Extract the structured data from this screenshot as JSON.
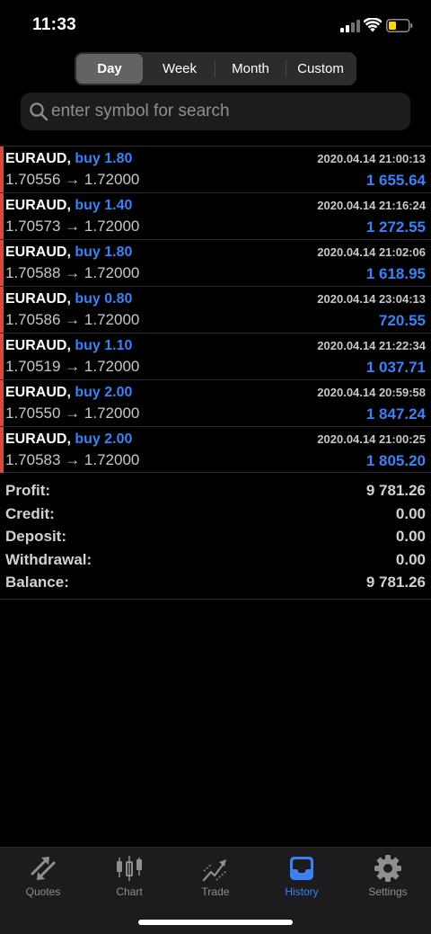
{
  "status_bar": {
    "time": "11:33"
  },
  "segments": [
    {
      "label": "Day",
      "active": true
    },
    {
      "label": "Week",
      "active": false
    },
    {
      "label": "Month",
      "active": false
    },
    {
      "label": "Custom",
      "active": false
    }
  ],
  "search": {
    "placeholder": "enter symbol for search",
    "value": ""
  },
  "deals": [
    {
      "symbol": "EURAUD,",
      "type": "buy 1.80",
      "prices": "1.70556 → 1.72000",
      "time": "2020.04.14 21:00:13",
      "profit": "1 655.64"
    },
    {
      "symbol": "EURAUD,",
      "type": "buy 1.40",
      "prices": "1.70573 → 1.72000",
      "time": "2020.04.14 21:16:24",
      "profit": "1 272.55"
    },
    {
      "symbol": "EURAUD,",
      "type": "buy 1.80",
      "prices": "1.70588 → 1.72000",
      "time": "2020.04.14 21:02:06",
      "profit": "1 618.95"
    },
    {
      "symbol": "EURAUD,",
      "type": "buy 0.80",
      "prices": "1.70586 → 1.72000",
      "time": "2020.04.14 23:04:13",
      "profit": "720.55"
    },
    {
      "symbol": "EURAUD,",
      "type": "buy 1.10",
      "prices": "1.70519 → 1.72000",
      "time": "2020.04.14 21:22:34",
      "profit": "1 037.71"
    },
    {
      "symbol": "EURAUD,",
      "type": "buy 2.00",
      "prices": "1.70550 → 1.72000",
      "time": "2020.04.14 20:59:58",
      "profit": "1 847.24"
    },
    {
      "symbol": "EURAUD,",
      "type": "buy 2.00",
      "prices": "1.70583 → 1.72000",
      "time": "2020.04.14 21:00:25",
      "profit": "1 805.20"
    }
  ],
  "summary": {
    "profit": {
      "label": "Profit:",
      "value": "9 781.26"
    },
    "credit": {
      "label": "Credit:",
      "value": "0.00"
    },
    "deposit": {
      "label": "Deposit:",
      "value": "0.00"
    },
    "withdrawal": {
      "label": "Withdrawal:",
      "value": "0.00"
    },
    "balance": {
      "label": "Balance:",
      "value": "9 781.26"
    }
  },
  "tabs": [
    {
      "label": "Quotes",
      "icon": "quotes-icon",
      "active": false
    },
    {
      "label": "Chart",
      "icon": "chart-icon",
      "active": false
    },
    {
      "label": "Trade",
      "icon": "trade-icon",
      "active": false
    },
    {
      "label": "History",
      "icon": "history-icon",
      "active": true
    },
    {
      "label": "Settings",
      "icon": "settings-icon",
      "active": false
    }
  ],
  "colors": {
    "accent": "#3c82f6",
    "buy_marker": "#d94a3d",
    "background": "#000000",
    "tab_bar": "#1c1c1e"
  }
}
